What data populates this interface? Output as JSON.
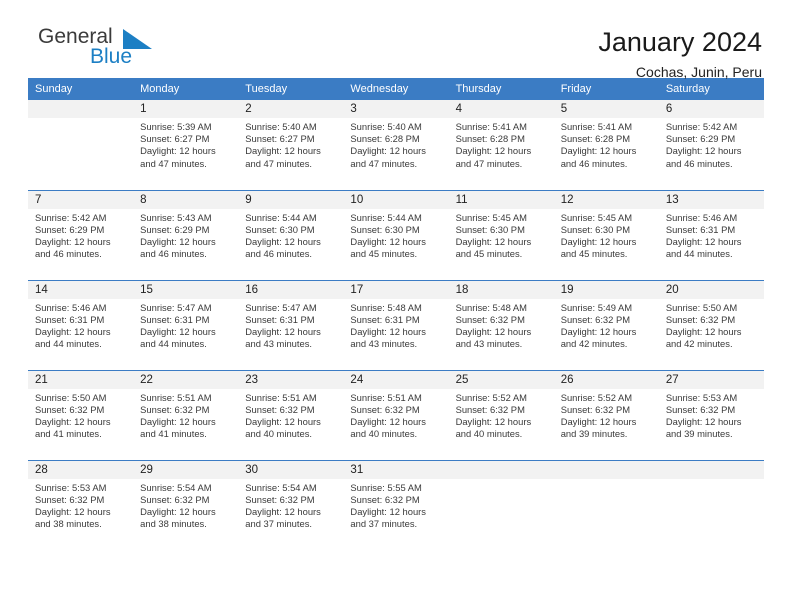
{
  "brand": {
    "word_top": "General",
    "word_bottom": "Blue",
    "flag_color": "#1c7fc4",
    "top_color": "#3b3b3b"
  },
  "header": {
    "title": "January 2024",
    "subtitle": "Cochas, Junin, Peru"
  },
  "theme": {
    "header_blue": "#3b7cc4",
    "daynum_bg": "#f2f2f2",
    "text": "#3a3a3a"
  },
  "weekday_headers": [
    "Sunday",
    "Monday",
    "Tuesday",
    "Wednesday",
    "Thursday",
    "Friday",
    "Saturday"
  ],
  "weeks": [
    [
      {
        "day": "",
        "sunrise": "",
        "sunset": "",
        "daylight": "",
        "daylight2": ""
      },
      {
        "day": "1",
        "sunrise": "Sunrise: 5:39 AM",
        "sunset": "Sunset: 6:27 PM",
        "daylight": "Daylight: 12 hours",
        "daylight2": "and 47 minutes."
      },
      {
        "day": "2",
        "sunrise": "Sunrise: 5:40 AM",
        "sunset": "Sunset: 6:27 PM",
        "daylight": "Daylight: 12 hours",
        "daylight2": "and 47 minutes."
      },
      {
        "day": "3",
        "sunrise": "Sunrise: 5:40 AM",
        "sunset": "Sunset: 6:28 PM",
        "daylight": "Daylight: 12 hours",
        "daylight2": "and 47 minutes."
      },
      {
        "day": "4",
        "sunrise": "Sunrise: 5:41 AM",
        "sunset": "Sunset: 6:28 PM",
        "daylight": "Daylight: 12 hours",
        "daylight2": "and 47 minutes."
      },
      {
        "day": "5",
        "sunrise": "Sunrise: 5:41 AM",
        "sunset": "Sunset: 6:28 PM",
        "daylight": "Daylight: 12 hours",
        "daylight2": "and 46 minutes."
      },
      {
        "day": "6",
        "sunrise": "Sunrise: 5:42 AM",
        "sunset": "Sunset: 6:29 PM",
        "daylight": "Daylight: 12 hours",
        "daylight2": "and 46 minutes."
      }
    ],
    [
      {
        "day": "7",
        "sunrise": "Sunrise: 5:42 AM",
        "sunset": "Sunset: 6:29 PM",
        "daylight": "Daylight: 12 hours",
        "daylight2": "and 46 minutes."
      },
      {
        "day": "8",
        "sunrise": "Sunrise: 5:43 AM",
        "sunset": "Sunset: 6:29 PM",
        "daylight": "Daylight: 12 hours",
        "daylight2": "and 46 minutes."
      },
      {
        "day": "9",
        "sunrise": "Sunrise: 5:44 AM",
        "sunset": "Sunset: 6:30 PM",
        "daylight": "Daylight: 12 hours",
        "daylight2": "and 46 minutes."
      },
      {
        "day": "10",
        "sunrise": "Sunrise: 5:44 AM",
        "sunset": "Sunset: 6:30 PM",
        "daylight": "Daylight: 12 hours",
        "daylight2": "and 45 minutes."
      },
      {
        "day": "11",
        "sunrise": "Sunrise: 5:45 AM",
        "sunset": "Sunset: 6:30 PM",
        "daylight": "Daylight: 12 hours",
        "daylight2": "and 45 minutes."
      },
      {
        "day": "12",
        "sunrise": "Sunrise: 5:45 AM",
        "sunset": "Sunset: 6:30 PM",
        "daylight": "Daylight: 12 hours",
        "daylight2": "and 45 minutes."
      },
      {
        "day": "13",
        "sunrise": "Sunrise: 5:46 AM",
        "sunset": "Sunset: 6:31 PM",
        "daylight": "Daylight: 12 hours",
        "daylight2": "and 44 minutes."
      }
    ],
    [
      {
        "day": "14",
        "sunrise": "Sunrise: 5:46 AM",
        "sunset": "Sunset: 6:31 PM",
        "daylight": "Daylight: 12 hours",
        "daylight2": "and 44 minutes."
      },
      {
        "day": "15",
        "sunrise": "Sunrise: 5:47 AM",
        "sunset": "Sunset: 6:31 PM",
        "daylight": "Daylight: 12 hours",
        "daylight2": "and 44 minutes."
      },
      {
        "day": "16",
        "sunrise": "Sunrise: 5:47 AM",
        "sunset": "Sunset: 6:31 PM",
        "daylight": "Daylight: 12 hours",
        "daylight2": "and 43 minutes."
      },
      {
        "day": "17",
        "sunrise": "Sunrise: 5:48 AM",
        "sunset": "Sunset: 6:31 PM",
        "daylight": "Daylight: 12 hours",
        "daylight2": "and 43 minutes."
      },
      {
        "day": "18",
        "sunrise": "Sunrise: 5:48 AM",
        "sunset": "Sunset: 6:32 PM",
        "daylight": "Daylight: 12 hours",
        "daylight2": "and 43 minutes."
      },
      {
        "day": "19",
        "sunrise": "Sunrise: 5:49 AM",
        "sunset": "Sunset: 6:32 PM",
        "daylight": "Daylight: 12 hours",
        "daylight2": "and 42 minutes."
      },
      {
        "day": "20",
        "sunrise": "Sunrise: 5:50 AM",
        "sunset": "Sunset: 6:32 PM",
        "daylight": "Daylight: 12 hours",
        "daylight2": "and 42 minutes."
      }
    ],
    [
      {
        "day": "21",
        "sunrise": "Sunrise: 5:50 AM",
        "sunset": "Sunset: 6:32 PM",
        "daylight": "Daylight: 12 hours",
        "daylight2": "and 41 minutes."
      },
      {
        "day": "22",
        "sunrise": "Sunrise: 5:51 AM",
        "sunset": "Sunset: 6:32 PM",
        "daylight": "Daylight: 12 hours",
        "daylight2": "and 41 minutes."
      },
      {
        "day": "23",
        "sunrise": "Sunrise: 5:51 AM",
        "sunset": "Sunset: 6:32 PM",
        "daylight": "Daylight: 12 hours",
        "daylight2": "and 40 minutes."
      },
      {
        "day": "24",
        "sunrise": "Sunrise: 5:51 AM",
        "sunset": "Sunset: 6:32 PM",
        "daylight": "Daylight: 12 hours",
        "daylight2": "and 40 minutes."
      },
      {
        "day": "25",
        "sunrise": "Sunrise: 5:52 AM",
        "sunset": "Sunset: 6:32 PM",
        "daylight": "Daylight: 12 hours",
        "daylight2": "and 40 minutes."
      },
      {
        "day": "26",
        "sunrise": "Sunrise: 5:52 AM",
        "sunset": "Sunset: 6:32 PM",
        "daylight": "Daylight: 12 hours",
        "daylight2": "and 39 minutes."
      },
      {
        "day": "27",
        "sunrise": "Sunrise: 5:53 AM",
        "sunset": "Sunset: 6:32 PM",
        "daylight": "Daylight: 12 hours",
        "daylight2": "and 39 minutes."
      }
    ],
    [
      {
        "day": "28",
        "sunrise": "Sunrise: 5:53 AM",
        "sunset": "Sunset: 6:32 PM",
        "daylight": "Daylight: 12 hours",
        "daylight2": "and 38 minutes."
      },
      {
        "day": "29",
        "sunrise": "Sunrise: 5:54 AM",
        "sunset": "Sunset: 6:32 PM",
        "daylight": "Daylight: 12 hours",
        "daylight2": "and 38 minutes."
      },
      {
        "day": "30",
        "sunrise": "Sunrise: 5:54 AM",
        "sunset": "Sunset: 6:32 PM",
        "daylight": "Daylight: 12 hours",
        "daylight2": "and 37 minutes."
      },
      {
        "day": "31",
        "sunrise": "Sunrise: 5:55 AM",
        "sunset": "Sunset: 6:32 PM",
        "daylight": "Daylight: 12 hours",
        "daylight2": "and 37 minutes."
      },
      {
        "day": "",
        "sunrise": "",
        "sunset": "",
        "daylight": "",
        "daylight2": ""
      },
      {
        "day": "",
        "sunrise": "",
        "sunset": "",
        "daylight": "",
        "daylight2": ""
      },
      {
        "day": "",
        "sunrise": "",
        "sunset": "",
        "daylight": "",
        "daylight2": ""
      }
    ]
  ]
}
